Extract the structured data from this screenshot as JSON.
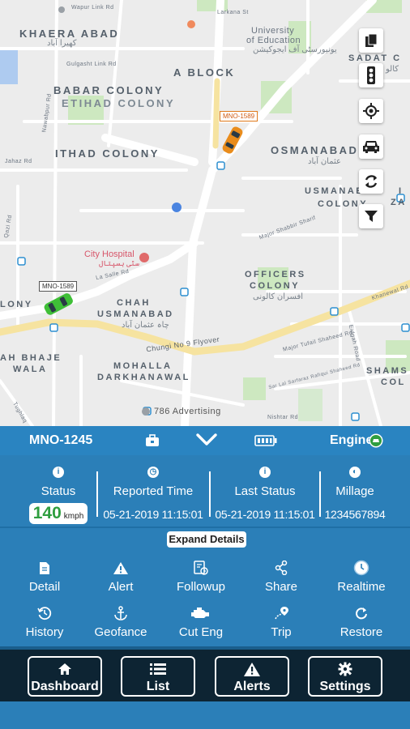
{
  "map": {
    "areas": [
      {
        "name": "KHAERA ABAD"
      },
      {
        "name": "A BLOCK"
      },
      {
        "name": "BABAR COLONY"
      },
      {
        "name": "ETIHAD COLONY"
      },
      {
        "name": "ITHAD COLONY"
      },
      {
        "name": "OSMANABAD"
      },
      {
        "name": "USMANABAD"
      },
      {
        "name": "COLONY"
      },
      {
        "name": "OFFICERS"
      },
      {
        "name": "COLONY"
      },
      {
        "name": "CHAH"
      },
      {
        "name": "USMANABAD"
      },
      {
        "name": "MOHALLA"
      },
      {
        "name": "DARKHANAWAL"
      },
      {
        "name": "LONY"
      },
      {
        "name": "AH BHAJE"
      },
      {
        "name": "WALA"
      },
      {
        "name": "SADAT C"
      },
      {
        "name": "ZA"
      },
      {
        "name": "SHAMS"
      },
      {
        "name": "COL"
      },
      {
        "name": "I"
      }
    ],
    "urdu": [
      "کھیرا آباد",
      "عثمان آباد",
      "چاہ عثمان آباد",
      "افسران کالونی",
      "کالو"
    ],
    "streets": [
      "Gulgasht Link Rd",
      "Wapur Link Rd",
      "Nawabpur Rd",
      "Major Shabbir Sharif",
      "La Salle Rd",
      "Chungi No 9 Flyover",
      "Khanewal Rd",
      "Major Tufail Shaheed Rd",
      "Sar Lal Sarfaraz Rafiqui Shaheed Rd",
      "Eidgah Road",
      "Nishtar Rd",
      "Tughlaq",
      "Qazi Rd",
      "Jahaz Rd",
      "Larkana St"
    ],
    "pois": {
      "university_line1": "University",
      "university_line2": "of Education",
      "university_urdu": "یونیورسٹی آف ایجوکیشن",
      "hospital": "City Hospital",
      "hospital_urdu": "سٹی ہسپتال",
      "advertising": "786 Advertising"
    },
    "vehicles": [
      {
        "plate": "MNO-1589",
        "color": "#e98c1c"
      },
      {
        "plate": "MNO-1589",
        "color": "#3fbf37"
      }
    ],
    "controls": [
      {
        "name": "copy-icon"
      },
      {
        "name": "traffic-light-icon"
      },
      {
        "name": "locate-icon"
      },
      {
        "name": "car-icon"
      },
      {
        "name": "refresh-icon"
      },
      {
        "name": "filter-icon"
      }
    ]
  },
  "panel": {
    "vehicle_id": "MNO-1245",
    "engine_label": "Engine",
    "engine_status_color": "#2f9e3f",
    "stats": {
      "status_label": "Status",
      "speed_value": "140",
      "speed_unit": "kmph",
      "reported_label": "Reported Time",
      "reported_value": "05-21-2019 11:15:01",
      "last_label": "Last Status",
      "last_value": "05-21-2019 11:15:01",
      "millage_label": "Millage",
      "millage_value": "1234567894"
    },
    "expand_label": "Expand Details",
    "actions": [
      {
        "label": "Detail",
        "icon": "document-icon"
      },
      {
        "label": "Alert",
        "icon": "warning-icon"
      },
      {
        "label": "Followup",
        "icon": "followup-icon"
      },
      {
        "label": "Share",
        "icon": "share-icon"
      },
      {
        "label": "Realtime",
        "icon": "clock-icon"
      },
      {
        "label": "History",
        "icon": "history-icon"
      },
      {
        "label": "Geofance",
        "icon": "anchor-icon"
      },
      {
        "label": "Cut Eng",
        "icon": "engine-icon"
      },
      {
        "label": "Trip",
        "icon": "trip-icon"
      },
      {
        "label": "Restore",
        "icon": "restore-icon"
      }
    ]
  },
  "nav": {
    "items": [
      {
        "label": "Dashboard",
        "icon": "home-icon"
      },
      {
        "label": "List",
        "icon": "list-icon"
      },
      {
        "label": "Alerts",
        "icon": "warning-icon"
      },
      {
        "label": "Settings",
        "icon": "gear-icon"
      }
    ]
  },
  "colors": {
    "panel_bg": "#2b7fb8",
    "nav_bg": "#0d2433",
    "road_highlight": "#f6e3a0"
  }
}
